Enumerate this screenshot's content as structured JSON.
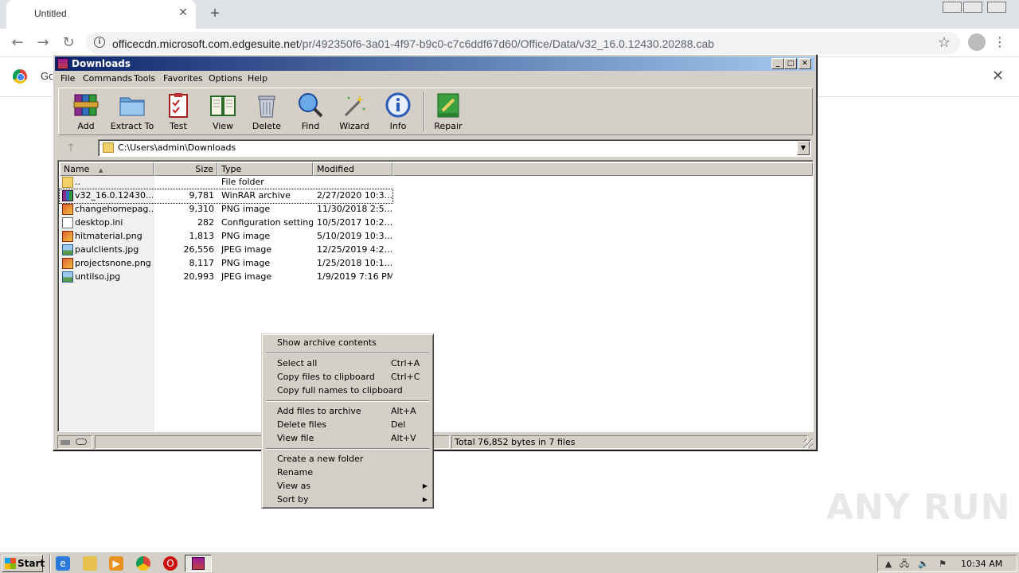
{
  "browser": {
    "tab_title": "Untitled",
    "url_host": "officecdn.microsoft.com.edgesuite.net",
    "url_path": "/pr/492350f6-3a01-4f97-b9c0-c7c6ddf67d60/Office/Data/v32_16.0.12430.20288.cab",
    "infobar_text": "Go"
  },
  "winrar": {
    "title": "Downloads",
    "menu": [
      "File",
      "Commands",
      "Tools",
      "Favorites",
      "Options",
      "Help"
    ],
    "tools": [
      {
        "label": "Add",
        "icon": "winrar-books-icon"
      },
      {
        "label": "Extract To",
        "icon": "blue-folder-icon"
      },
      {
        "label": "Test",
        "icon": "clipboard-check-icon"
      },
      {
        "label": "View",
        "icon": "open-book-icon"
      },
      {
        "label": "Delete",
        "icon": "trash-can-icon"
      },
      {
        "label": "Find",
        "icon": "magnifier-icon"
      },
      {
        "label": "Wizard",
        "icon": "magic-wand-icon"
      },
      {
        "label": "Info",
        "icon": "info-icon"
      },
      {
        "label": "Repair",
        "icon": "repair-kit-icon"
      }
    ],
    "address": "C:\\Users\\admin\\Downloads",
    "columns": [
      "Name",
      "Size",
      "Type",
      "Modified"
    ],
    "files": [
      {
        "name": "..",
        "size": "",
        "type": "File folder",
        "modified": "",
        "icon": "parent-folder-icon"
      },
      {
        "name": "v32_16.0.12430....",
        "size": "9,781",
        "type": "WinRAR archive",
        "modified": "2/27/2020 10:3...",
        "icon": "rar-archive-icon"
      },
      {
        "name": "changehomepag...",
        "size": "9,310",
        "type": "PNG image",
        "modified": "11/30/2018 2:5...",
        "icon": "png-image-icon"
      },
      {
        "name": "desktop.ini",
        "size": "282",
        "type": "Configuration settings",
        "modified": "10/5/2017 10:2...",
        "icon": "ini-file-icon"
      },
      {
        "name": "hitmaterial.png",
        "size": "1,813",
        "type": "PNG image",
        "modified": "5/10/2019 10:3...",
        "icon": "png-image-icon"
      },
      {
        "name": "paulclients.jpg",
        "size": "26,556",
        "type": "JPEG image",
        "modified": "12/25/2019 4:2...",
        "icon": "jpeg-image-icon"
      },
      {
        "name": "projectsnone.png",
        "size": "8,117",
        "type": "PNG image",
        "modified": "1/25/2018 10:1...",
        "icon": "png-image-icon"
      },
      {
        "name": "untilso.jpg",
        "size": "20,993",
        "type": "JPEG image",
        "modified": "1/9/2019 7:16 PM",
        "icon": "jpeg-image-icon"
      }
    ],
    "status_total": "Total 76,852 bytes in 7 files"
  },
  "context_menu": {
    "items": [
      {
        "label": "Show archive contents",
        "shortcut": ""
      },
      {
        "label": "Select all",
        "shortcut": "Ctrl+A"
      },
      {
        "label": "Copy files to clipboard",
        "shortcut": "Ctrl+C"
      },
      {
        "label": "Copy full names to clipboard",
        "shortcut": ""
      },
      {
        "label": "Add files to archive",
        "shortcut": "Alt+A"
      },
      {
        "label": "Delete files",
        "shortcut": "Del"
      },
      {
        "label": "View file",
        "shortcut": "Alt+V"
      },
      {
        "label": "Create a new folder",
        "shortcut": ""
      },
      {
        "label": "Rename",
        "shortcut": ""
      },
      {
        "label": "View as",
        "shortcut": ""
      },
      {
        "label": "Sort by",
        "shortcut": ""
      }
    ]
  },
  "taskbar": {
    "start_label": "Start",
    "clock": "10:34 AM"
  },
  "watermark": "ANY RUN"
}
